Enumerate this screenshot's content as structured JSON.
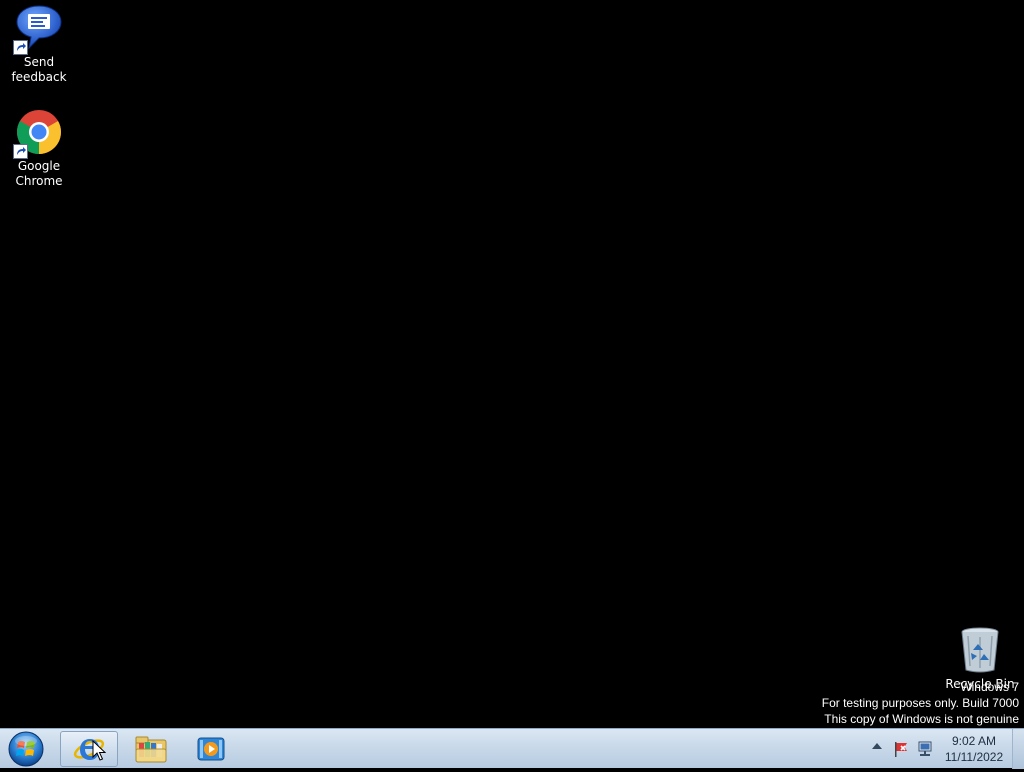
{
  "desktop": {
    "icons": [
      {
        "label": "Send feedback",
        "icon": "send-feedback-icon"
      },
      {
        "label": "Google Chrome",
        "icon": "google-chrome-icon"
      },
      {
        "label": "Recycle Bin",
        "icon": "recycle-bin-icon"
      }
    ],
    "watermark": {
      "os_label": "Windows 7",
      "line1": "For testing purposes only. Build 7000",
      "line2": "This copy of Windows is not genuine"
    }
  },
  "taskbar": {
    "start": {
      "icon": "windows-start-orb-icon"
    },
    "pinned": [
      {
        "name": "Internet Explorer",
        "icon": "internet-explorer-icon",
        "active": true
      },
      {
        "name": "Windows Explorer",
        "icon": "folder-library-icon",
        "active": false
      },
      {
        "name": "Windows Media Player",
        "icon": "media-player-icon",
        "active": false
      }
    ],
    "tray": {
      "icons": [
        "show-hidden-icons-arrow-icon",
        "action-center-flag-icon",
        "network-icon"
      ],
      "time": "9:02 AM",
      "date": "11/11/2022"
    }
  },
  "colors": {
    "desktop_bg": "#000000",
    "taskbar_top": "#dbe7f3",
    "taskbar_bottom": "#b7cbe0",
    "text_light": "#ffffff",
    "clock_text": "#1e2d40"
  }
}
